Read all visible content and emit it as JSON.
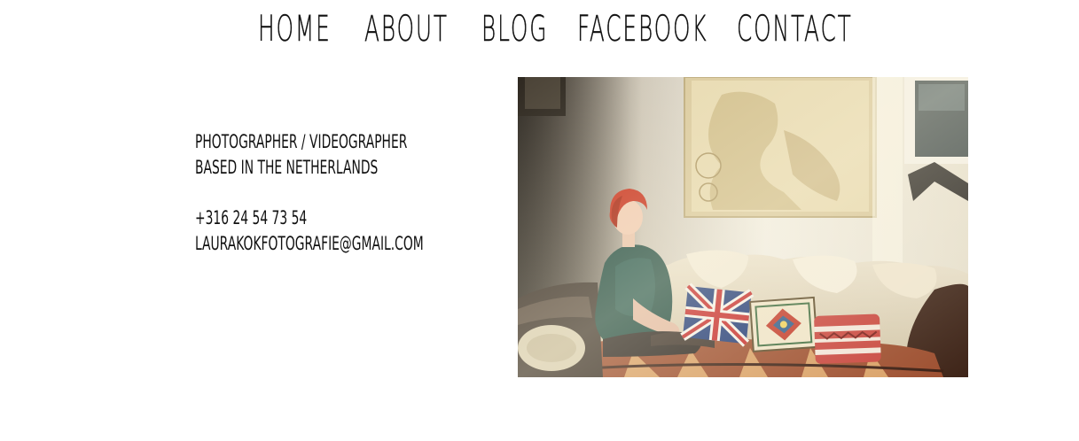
{
  "nav": {
    "items": [
      {
        "label": "HOME"
      },
      {
        "label": "ABOUT"
      },
      {
        "label": "BLOG"
      },
      {
        "label": "FACEBOOK"
      },
      {
        "label": "CONTACT"
      }
    ]
  },
  "info": {
    "line1": "PHOTOGRAPHER / VIDEOGRAPHER",
    "line2": "BASED IN THE NETHERLANDS",
    "phone": "+316 24 54 73 54",
    "email": "LAURAKOKFOTOGRAFIE@GMAIL.COM"
  },
  "colors": {
    "text": "#111111",
    "background": "#ffffff"
  }
}
